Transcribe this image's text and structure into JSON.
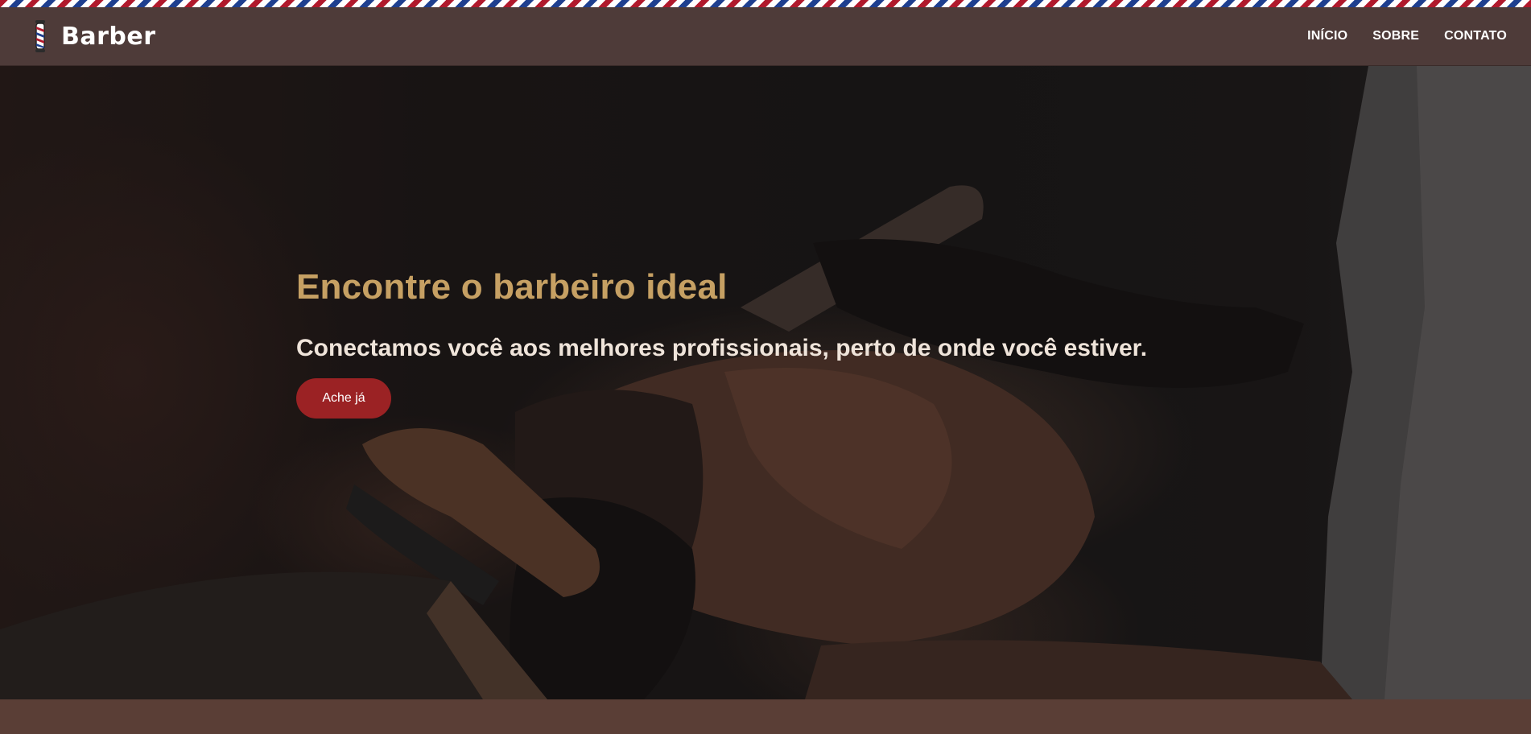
{
  "header": {
    "brand_name": "Barber",
    "brand_icon": "barber-pole-icon",
    "nav": [
      {
        "label": "INÍCIO"
      },
      {
        "label": "SOBRE"
      },
      {
        "label": "CONTATO"
      }
    ]
  },
  "hero": {
    "title": "Encontre o barbeiro ideal",
    "subtitle": "Conectamos você aos melhores profissionais, perto de onde você estiver.",
    "cta_label": "Ache já",
    "background_image": "barber-shaving-client-photo"
  },
  "colors": {
    "navbar": "#4e3b39",
    "title_gold": "#c6a063",
    "cta_red": "#9b2224",
    "footer_brown": "#5a3e36",
    "pole_red": "#b0192c",
    "pole_blue": "#1e3f8f"
  }
}
